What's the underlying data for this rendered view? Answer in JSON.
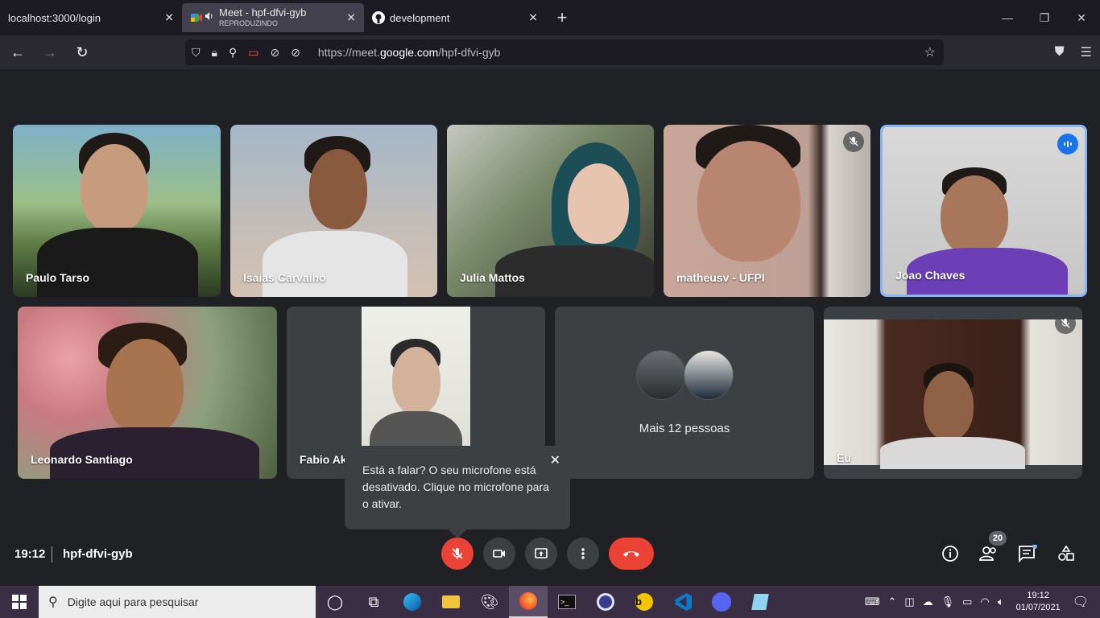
{
  "browser": {
    "tabs": [
      {
        "title": "localhost:3000/login",
        "subtitle": ""
      },
      {
        "title": "Meet - hpf-dfvi-gyb",
        "subtitle": "REPRODUZINDO"
      },
      {
        "title": "development",
        "subtitle": ""
      }
    ],
    "new_tab": "+",
    "url_prefix": "https://meet.",
    "url_domain": "google.com",
    "url_path": "/hpf-dfvi-gyb"
  },
  "participants": [
    {
      "name": "Paulo Tarso"
    },
    {
      "name": "Isaias Carvalho"
    },
    {
      "name": "Julia Mattos"
    },
    {
      "name": "matheusv - UFPI"
    },
    {
      "name": "Joao Chaves"
    },
    {
      "name": "Leonardo Santiago"
    },
    {
      "name": "Fabio Ak"
    },
    {
      "name": "Eu"
    }
  ],
  "more_people": "Mais 12 pessoas",
  "tooltip": {
    "text": "Está a falar? O seu microfone está desativado. Clique no microfone para o ativar."
  },
  "meeting": {
    "time": "19:12",
    "code": "hpf-dfvi-gyb",
    "participant_count": "20"
  },
  "taskbar": {
    "search_placeholder": "Digite aqui para pesquisar",
    "clock_time": "19:12",
    "clock_date": "01/07/2021"
  },
  "colors": {
    "accent_blue": "#8ab4f8",
    "hangup_red": "#ea4335",
    "meet_bg": "#202124",
    "taskbar": "#3a2e44"
  }
}
